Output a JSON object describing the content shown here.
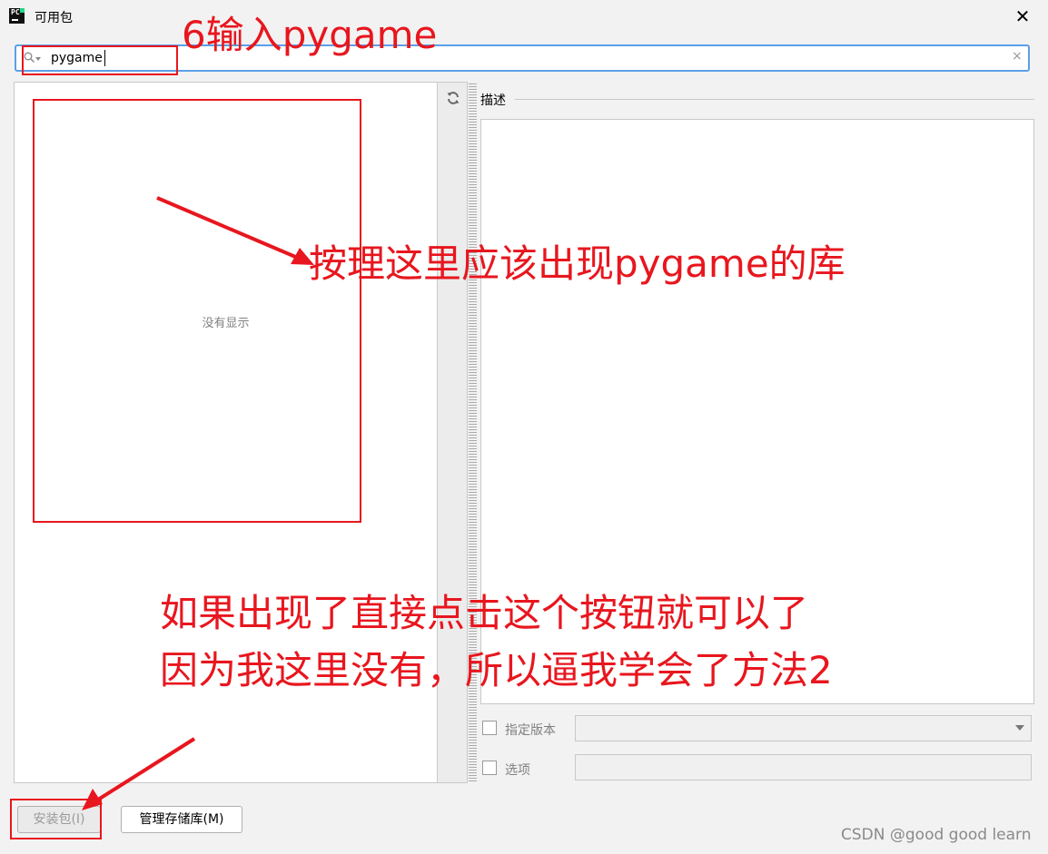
{
  "window": {
    "title": "可用包",
    "app_icon_text": "PC",
    "close_glyph": "✕"
  },
  "search": {
    "value": "pygame",
    "clear_glyph": "×"
  },
  "package_list": {
    "empty_text": "没有显示"
  },
  "description": {
    "label": "描述"
  },
  "options": {
    "specify_version_label": "指定版本",
    "options_label": "选项"
  },
  "buttons": {
    "install_label": "安装包(I)",
    "manage_repos_label": "管理存储库(M)"
  },
  "annotations": {
    "step": "6输入pygame",
    "expected": "按理这里应该出现pygame的库",
    "note_line1": "如果出现了直接点击这个按钮就可以了",
    "note_line2": "因为我这里没有，所以逼我学会了方法2",
    "color": "#e8161e"
  },
  "watermark": "CSDN @good good learn",
  "colors": {
    "focus_border": "#5aa0e8",
    "window_bg": "#f2f2f2"
  }
}
